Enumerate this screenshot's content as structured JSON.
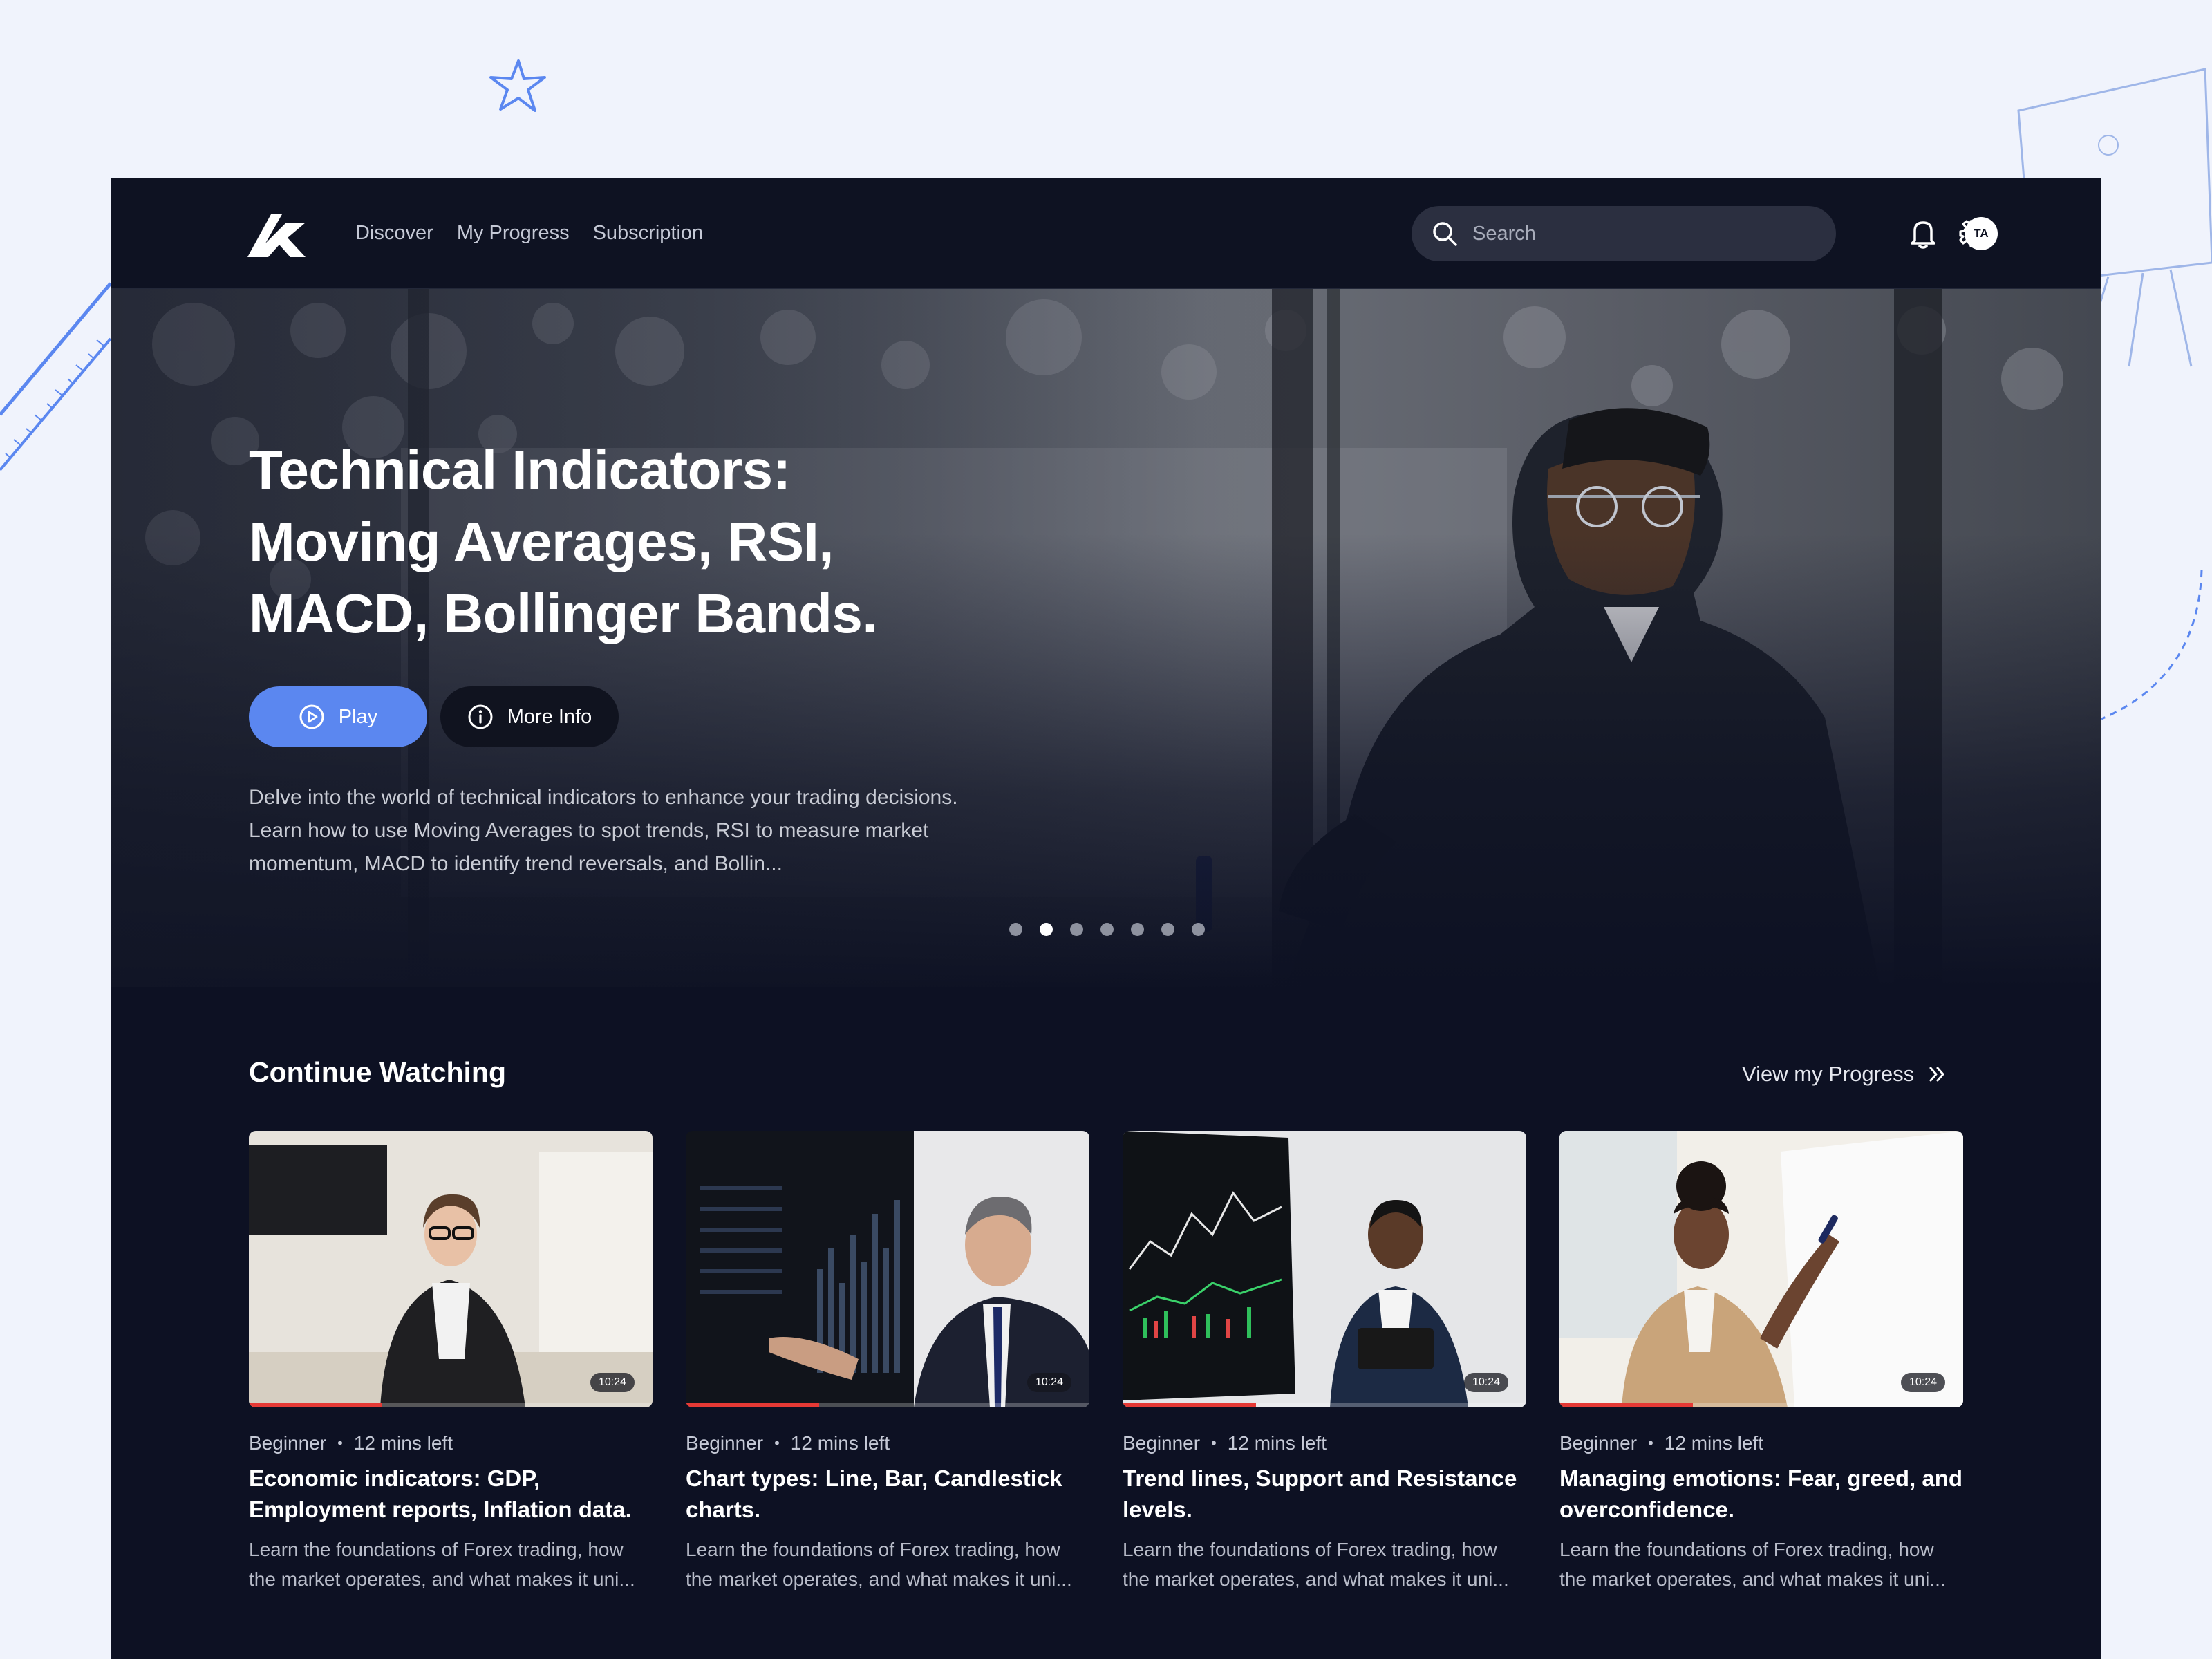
{
  "brand": {
    "logo_icon": "k-logo-icon",
    "accent": "#5b87f0",
    "bg": "#0d1123"
  },
  "nav": {
    "links": [
      "Discover",
      "My Progress",
      "Subscription"
    ],
    "search_placeholder": "Search",
    "icons": [
      "bell-icon",
      "gear-icon"
    ],
    "avatar_initials": "TA"
  },
  "hero": {
    "title_lines": [
      "Technical Indicators:",
      "Moving Averages, RSI,",
      "MACD, Bollinger Bands."
    ],
    "play_label": "Play",
    "more_info_label": "More Info",
    "description": "Delve into the world of technical indicators to enhance your trading decisions. Learn how to use Moving Averages to spot trends, RSI to measure market momentum, MACD to identify trend reversals, and Bollin...",
    "slide_count": 7,
    "active_slide": 2
  },
  "continue_watching": {
    "title": "Continue Watching",
    "view_progress_label": "View my Progress",
    "cards": [
      {
        "level": "Beginner",
        "time_left": "12 mins left",
        "title": "Economic indicators: GDP, Employment reports, Inflation data.",
        "description": "Learn the foundations of Forex trading, how the market operates, and what makes it uni...",
        "duration": "10:24",
        "progress": 0.33
      },
      {
        "level": "Beginner",
        "time_left": "12 mins left",
        "title": "Chart types: Line, Bar, Candlestick charts.",
        "description": "Learn the foundations of Forex trading, how the market operates, and what makes it uni...",
        "duration": "10:24",
        "progress": 0.33
      },
      {
        "level": "Beginner",
        "time_left": "12 mins left",
        "title": "Trend lines, Support and Resistance levels.",
        "description": "Learn the foundations of Forex trading, how the market operates, and what makes it uni...",
        "duration": "10:24",
        "progress": 0.33
      },
      {
        "level": "Beginner",
        "time_left": "12 mins left",
        "title": "Managing emotions: Fear, greed, and overconfidence.",
        "description": "Learn the foundations of Forex trading, how the market operates, and what makes it uni...",
        "duration": "10:24",
        "progress": 0.33
      }
    ]
  }
}
